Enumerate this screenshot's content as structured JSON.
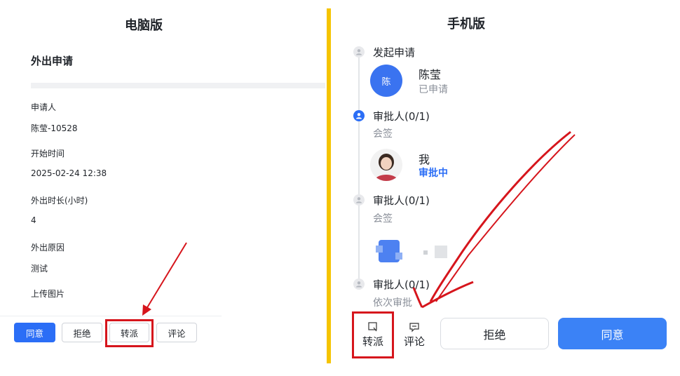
{
  "desktop": {
    "section_title": "电脑版",
    "form_title": "外出申请",
    "fields": [
      {
        "label": "申请人",
        "value": "陈莹-10528"
      },
      {
        "label": "开始时间",
        "value": "2025-02-24 12:38"
      },
      {
        "label": "外出时长(小时)",
        "value": "4"
      },
      {
        "label": "外出原因",
        "value": "测试"
      },
      {
        "label": "上传图片",
        "value": ""
      }
    ],
    "buttons": {
      "agree": "同意",
      "reject": "拒绝",
      "transfer": "转派",
      "comment": "评论"
    }
  },
  "mobile": {
    "section_title": "手机版",
    "timeline": [
      {
        "title": "发起申请",
        "name": "陈莹",
        "avatar_text": "陈",
        "status": "已申请"
      },
      {
        "title": "审批人(0/1)",
        "sub": "会签",
        "name": "我",
        "status": "审批中"
      },
      {
        "title": "审批人(0/1)",
        "sub": "会签"
      },
      {
        "title": "审批人(0/1)",
        "sub": "依次审批"
      }
    ],
    "toolbar": {
      "transfer": "转派",
      "comment": "评论",
      "reject": "拒绝",
      "agree": "同意"
    }
  },
  "colors": {
    "primary": "#2b6ef6",
    "highlight_red": "#d6151c",
    "divider_yellow": "#f5c400"
  }
}
